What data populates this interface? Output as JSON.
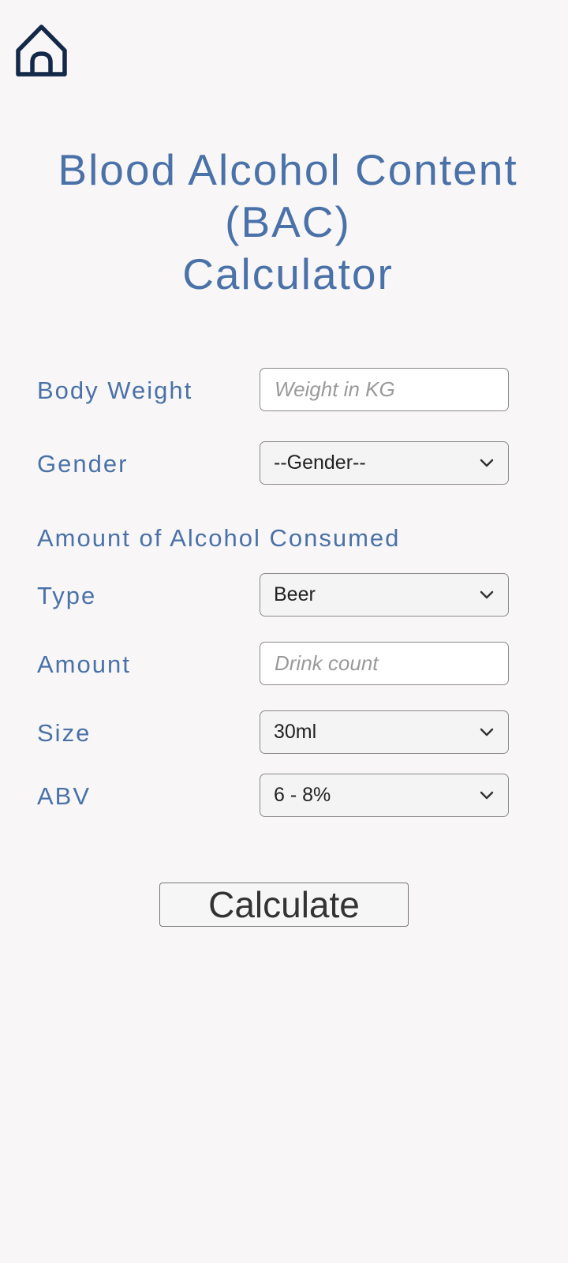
{
  "header": {
    "home_icon": "home-icon"
  },
  "title": {
    "line1": "Blood Alcohol Content",
    "line2": "(BAC)",
    "line3": "Calculator"
  },
  "form": {
    "body_weight": {
      "label": "Body Weight",
      "placeholder": "Weight in KG",
      "value": ""
    },
    "gender": {
      "label": "Gender",
      "selected": "--Gender--"
    },
    "section_heading": "Amount of Alcohol Consumed",
    "type": {
      "label": "Type",
      "selected": "Beer"
    },
    "amount": {
      "label": "Amount",
      "placeholder": "Drink count",
      "value": ""
    },
    "size": {
      "label": "Size",
      "selected": "30ml"
    },
    "abv": {
      "label": "ABV",
      "selected": "6 - 8%"
    },
    "submit_label": "Calculate"
  },
  "colors": {
    "accent": "#4a72a8",
    "background": "#f8f6f7",
    "home_icon": "#14294a"
  }
}
